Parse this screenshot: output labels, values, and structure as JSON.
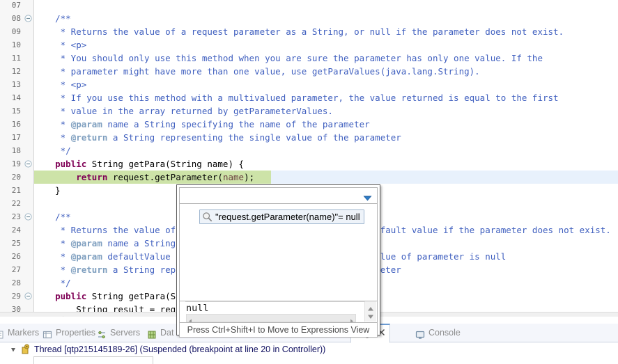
{
  "editor": {
    "lines": [
      {
        "num": "07",
        "fold": false,
        "segments": []
      },
      {
        "num": "08",
        "fold": true,
        "segments": [
          {
            "t": "    /**",
            "c": "cmt"
          }
        ]
      },
      {
        "num": "09",
        "fold": false,
        "segments": [
          {
            "t": "     * Returns the value of a request parameter as a String, or null if the parameter does not exist.",
            "c": "cmt"
          }
        ]
      },
      {
        "num": "10",
        "fold": false,
        "segments": [
          {
            "t": "     * <p>",
            "c": "cmt"
          }
        ]
      },
      {
        "num": "11",
        "fold": false,
        "segments": [
          {
            "t": "     * You should only use this method when you are sure the parameter has only one value. If the",
            "c": "cmt"
          }
        ]
      },
      {
        "num": "12",
        "fold": false,
        "segments": [
          {
            "t": "     * parameter might have more than one value, use getParaValues(java.lang.String).",
            "c": "cmt"
          }
        ]
      },
      {
        "num": "13",
        "fold": false,
        "segments": [
          {
            "t": "     * <p>",
            "c": "cmt"
          }
        ]
      },
      {
        "num": "14",
        "fold": false,
        "segments": [
          {
            "t": "     * If you use this method with a multivalued parameter, the value returned is equal to the first",
            "c": "cmt"
          }
        ]
      },
      {
        "num": "15",
        "fold": false,
        "segments": [
          {
            "t": "     * value in the array returned by getParameterValues.",
            "c": "cmt"
          }
        ]
      },
      {
        "num": "16",
        "fold": false,
        "segments": [
          {
            "t": "     * ",
            "c": "cmt"
          },
          {
            "t": "@param",
            "c": "cmt-tag"
          },
          {
            "t": " name a String specifying the name of the parameter",
            "c": "cmt"
          }
        ]
      },
      {
        "num": "17",
        "fold": false,
        "segments": [
          {
            "t": "     * ",
            "c": "cmt"
          },
          {
            "t": "@return",
            "c": "cmt-tag"
          },
          {
            "t": " a String representing the single value of the parameter",
            "c": "cmt"
          }
        ]
      },
      {
        "num": "18",
        "fold": false,
        "segments": [
          {
            "t": "     */",
            "c": "cmt"
          }
        ]
      },
      {
        "num": "19",
        "fold": true,
        "segments": [
          {
            "t": "    ",
            "c": "plain"
          },
          {
            "t": "public",
            "c": "kw"
          },
          {
            "t": " String getPara(String name) {",
            "c": "plain"
          }
        ]
      },
      {
        "num": "20",
        "fold": false,
        "segments": [
          {
            "t": "        ",
            "c": "plain"
          },
          {
            "t": "return",
            "c": "kw"
          },
          {
            "t": " request.getParameter(",
            "c": "plain"
          },
          {
            "t": "name",
            "c": "loc"
          },
          {
            "t": ");",
            "c": "plain"
          }
        ]
      },
      {
        "num": "21",
        "fold": false,
        "segments": [
          {
            "t": "    }",
            "c": "plain"
          }
        ]
      },
      {
        "num": "22",
        "fold": false,
        "segments": []
      },
      {
        "num": "23",
        "fold": true,
        "segments": [
          {
            "t": "    /**",
            "c": "cmt"
          }
        ]
      },
      {
        "num": "24",
        "fold": false,
        "segments": [
          {
            "t": "     * Returns the value of a request parameter as a String, or default value if the parameter does not exist.",
            "c": "cmt"
          }
        ]
      },
      {
        "num": "25",
        "fold": false,
        "segments": [
          {
            "t": "     * ",
            "c": "cmt"
          },
          {
            "t": "@param",
            "c": "cmt-tag"
          },
          {
            "t": " name a String specifying the name of the parameter",
            "c": "cmt"
          }
        ]
      },
      {
        "num": "26",
        "fold": false,
        "segments": [
          {
            "t": "     * ",
            "c": "cmt"
          },
          {
            "t": "@param",
            "c": "cmt-tag"
          },
          {
            "t": " defaultValue a default value will return when the value of parameter is null",
            "c": "cmt"
          }
        ]
      },
      {
        "num": "27",
        "fold": false,
        "segments": [
          {
            "t": "     * ",
            "c": "cmt"
          },
          {
            "t": "@return",
            "c": "cmt-tag"
          },
          {
            "t": " a String representing the single value of the parameter",
            "c": "cmt"
          }
        ]
      },
      {
        "num": "28",
        "fold": false,
        "segments": [
          {
            "t": "     */",
            "c": "cmt"
          }
        ]
      },
      {
        "num": "29",
        "fold": true,
        "segments": [
          {
            "t": "    ",
            "c": "plain"
          },
          {
            "t": "public",
            "c": "kw"
          },
          {
            "t": " String getPara(String name, String defaultValue) {",
            "c": "plain"
          }
        ]
      },
      {
        "num": "30",
        "fold": false,
        "segments": [
          {
            "t": "        String result = request.getParameter(name);",
            "c": "plain"
          }
        ]
      }
    ],
    "highlight_line_index": 13,
    "highlight_green_width": 340,
    "colors": {
      "current_line_green": "#cde3a8",
      "selection_blue": "#e8f1fc",
      "comment": "#3f5fbf",
      "keyword": "#7f0055",
      "javadoc_tag": "#7f9fbf",
      "local_var": "#6a3e3e"
    }
  },
  "popup": {
    "expression": "\"request.getParameter(name)\"= null",
    "detail_value": "null",
    "footer_hint": "Press Ctrl+Shift+I to Move to Expressions View",
    "search_icon_name": "magnifier-icon",
    "caret_icon_name": "chevron-down-icon"
  },
  "bottom_panel": {
    "tabs": [
      {
        "label": "Markers",
        "icon": "markers-icon",
        "active": false
      },
      {
        "label": "Properties",
        "icon": "properties-icon",
        "active": false
      },
      {
        "label": "Servers",
        "icon": "servers-icon",
        "active": false
      },
      {
        "label": "Dat",
        "icon": "database-icon",
        "active": false
      },
      {
        "label": "bug",
        "icon": "debug-icon",
        "active": true,
        "closable": true
      },
      {
        "label": "Console",
        "icon": "console-icon",
        "active": false
      }
    ],
    "thread": {
      "label": "Thread [qtp215145189-26] (Suspended (breakpoint at line 20 in Controller))",
      "icon": "thread-suspended-icon",
      "expander": "collapsed-triangle-icon"
    }
  }
}
